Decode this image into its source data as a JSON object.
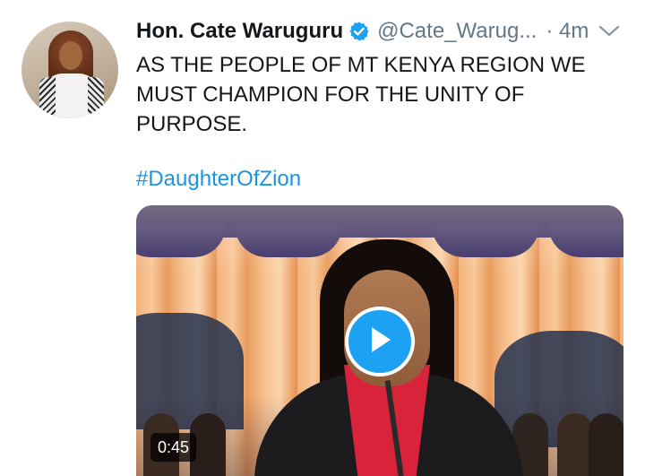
{
  "tweet": {
    "author": {
      "display_name": "Hon. Cate Waruguru",
      "handle": "@Cate_Warug...",
      "verified": true,
      "avatar_icon": "profile-photo"
    },
    "timestamp": "· 4m",
    "text_lines": [
      "AS THE PEOPLE OF MT KENYA REGION WE",
      "MUST CHAMPION FOR THE UNITY OF",
      "PURPOSE."
    ],
    "hashtag": "#DaughterOfZion",
    "media": {
      "type": "video",
      "duration": "0:45",
      "play_icon": "play-icon"
    },
    "menu_icon": "chevron-down-icon"
  },
  "colors": {
    "text": "#14171a",
    "secondary": "#657786",
    "link": "#1b95e0",
    "accent": "#1da1f2"
  }
}
